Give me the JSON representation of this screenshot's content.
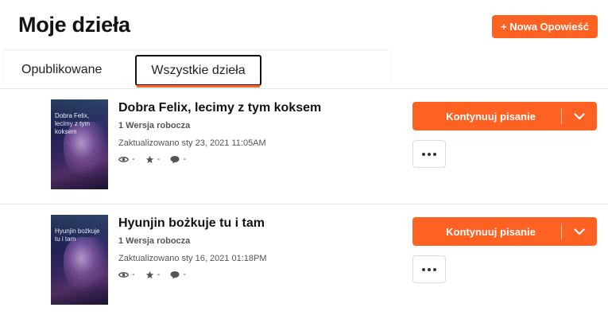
{
  "header": {
    "title": "Moje dzieła",
    "new_story_label": "+ Nowa Opowieść"
  },
  "tabs": [
    {
      "label": "Opublikowane",
      "active": false
    },
    {
      "label": "Wszystkie dzieła",
      "active": true
    }
  ],
  "stories": [
    {
      "title": "Dobra Felix, lecimy z tym koksem",
      "cover_text": "Dobra Felix, lecimy z tym koksem",
      "drafts": "1 Wersja robocza",
      "updated": "Zaktualizowano sty 23, 2021 11:05AM",
      "reads": "-",
      "votes": "-",
      "comments": "-",
      "continue_label": "Kontynuuj pisanie"
    },
    {
      "title": "Hyunjin bożkuje tu i tam",
      "cover_text": "Hyunjin bożkuje tu i tam",
      "drafts": "1 Wersja robocza",
      "updated": "Zaktualizowano sty 16, 2021 01:18PM",
      "reads": "-",
      "votes": "-",
      "comments": "-",
      "continue_label": "Kontynuuj pisanie"
    }
  ],
  "icons": {
    "reads": "eye-icon",
    "votes": "star-icon",
    "comments": "comment-icon",
    "dropdown": "chevron-down-icon",
    "more": "more-options-icon"
  },
  "colors": {
    "accent": "#ff6122",
    "text": "#121212",
    "muted": "#555555",
    "divider": "#e6e6e6"
  }
}
